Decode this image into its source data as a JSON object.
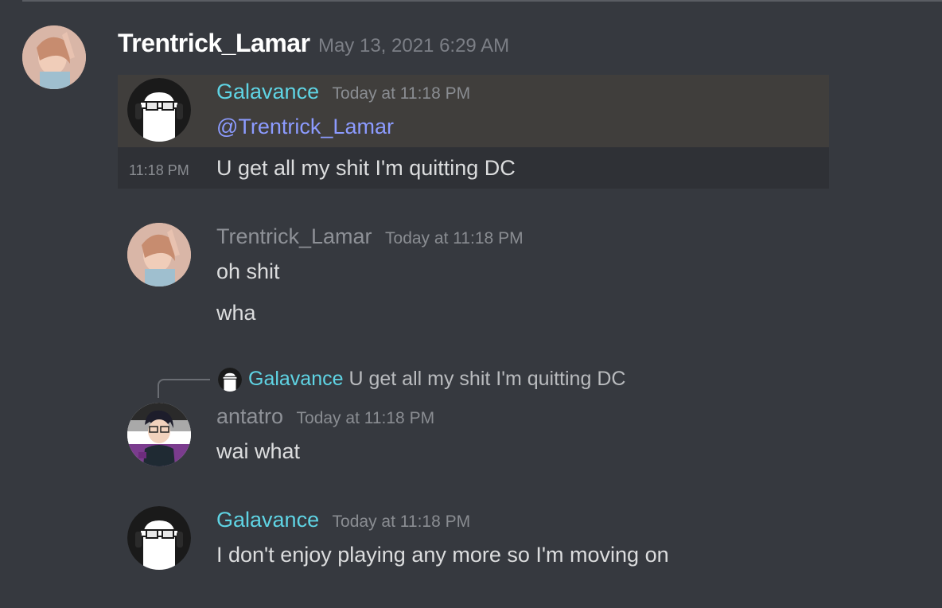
{
  "outer": {
    "username": "Trentrick_Lamar",
    "timestamp": "May 13, 2021 6:29 AM"
  },
  "embed": {
    "author": "Galavance",
    "author_time": "Today at 11:18 PM",
    "mention": "@Trentrick_Lamar",
    "row_time": "11:18 PM",
    "row_text": "U get all my shit I'm quitting DC"
  },
  "messages": [
    {
      "author": "Trentrick_Lamar",
      "time": "Today at 11:18 PM",
      "lines": [
        "oh shit",
        "wha"
      ]
    },
    {
      "reply": {
        "author": "Galavance",
        "text": "U get all my shit I'm quitting DC"
      },
      "author": "antatro",
      "time": "Today at 11:18 PM",
      "lines": [
        "wai what"
      ]
    },
    {
      "author": "Galavance",
      "time": "Today at 11:18 PM",
      "lines": [
        "I don't enjoy playing any more so I'm moving on"
      ]
    }
  ],
  "colors": {
    "background": "#36393f",
    "embed_bg": "#2f3136",
    "embed_header_bg": "#403e3c",
    "username_cyan": "#5fd4e4",
    "mention": "#8c9bff"
  },
  "icons": [
    "ghost-avatar-icon",
    "profile-photo-avatar",
    "anime-avatar-icon",
    "reply-connector-icon"
  ]
}
